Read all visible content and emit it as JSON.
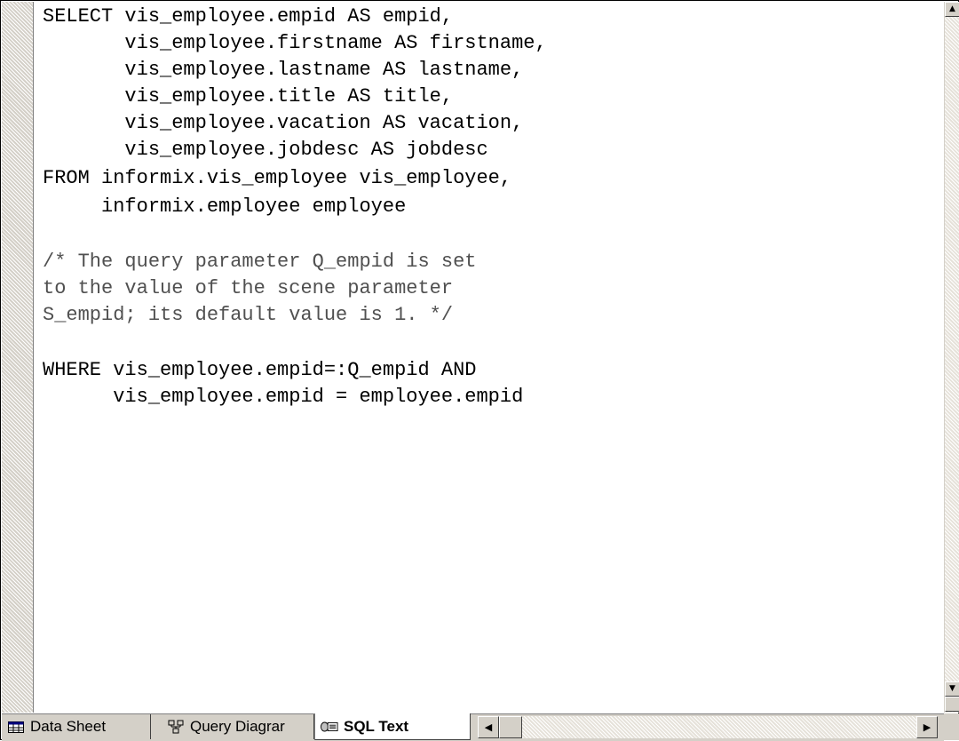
{
  "sql_lines": [
    "SELECT vis_employee.empid AS empid,",
    "       vis_employee.firstname AS firstname,",
    "       vis_employee.lastname AS lastname,",
    "       vis_employee.title AS title,",
    "       vis_employee.vacation AS vacation,",
    "       vis_employee.jobdesc AS jobdesc",
    "FROM informix.vis_employee vis_employee,",
    "     informix.employee employee",
    "",
    "/* The query parameter Q_empid is set",
    "to the value of the scene parameter",
    "S_empid; its default value is 1. */",
    "",
    "WHERE vis_employee.empid=:Q_empid AND",
    "      vis_employee.empid = employee.empid"
  ],
  "tabs": [
    {
      "label": "Data Sheet",
      "icon": "grid-icon",
      "active": false
    },
    {
      "label": "Query Diagrar",
      "icon": "diagram-icon",
      "active": false
    },
    {
      "label": "SQL Text",
      "icon": "sql-icon",
      "active": true
    }
  ],
  "scrollbar": {
    "up_arrow": "▲",
    "down_arrow": "▼",
    "left_arrow": "◀",
    "right_arrow": "▶"
  }
}
